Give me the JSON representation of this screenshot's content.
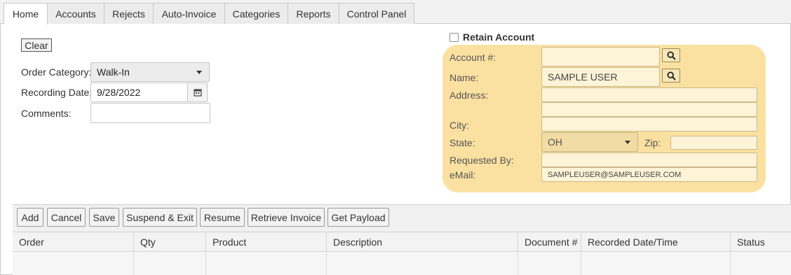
{
  "tabs": [
    "Home",
    "Accounts",
    "Rejects",
    "Auto-Invoice",
    "Categories",
    "Reports",
    "Control Panel"
  ],
  "left_form": {
    "clear_label": "Clear",
    "order_category_label": "Order Category:",
    "order_category_value": "Walk-In",
    "recording_date_label": "Recording Date:",
    "recording_date_value": "9/28/2022",
    "comments_label": "Comments:",
    "comments_value": ""
  },
  "account_panel": {
    "retain_label": "Retain Account",
    "account_label": "Account #:",
    "account_value": "",
    "name_label": "Name:",
    "name_value": "SAMPLE USER",
    "address_label": "Address:",
    "address_line1": "",
    "address_line2": "",
    "city_label": "City:",
    "city_value": "",
    "state_label": "State:",
    "state_value": "OH",
    "zip_label": "Zip:",
    "zip_value": "",
    "requested_by_label": "Requested By:",
    "requested_by_value": "",
    "email_label": "eMail:",
    "email_value": "SAMPLEUSER@SAMPLEUSER.COM",
    "panel_color": "#fbe1a1"
  },
  "toolbar": [
    "Add",
    "Cancel",
    "Save",
    "Suspend & Exit",
    "Resume",
    "Retrieve Invoice",
    "Get Payload"
  ],
  "grid": {
    "columns": [
      "Order",
      "Qty",
      "Product",
      "Description",
      "Document #",
      "Recorded Date/Time",
      "Status"
    ]
  }
}
